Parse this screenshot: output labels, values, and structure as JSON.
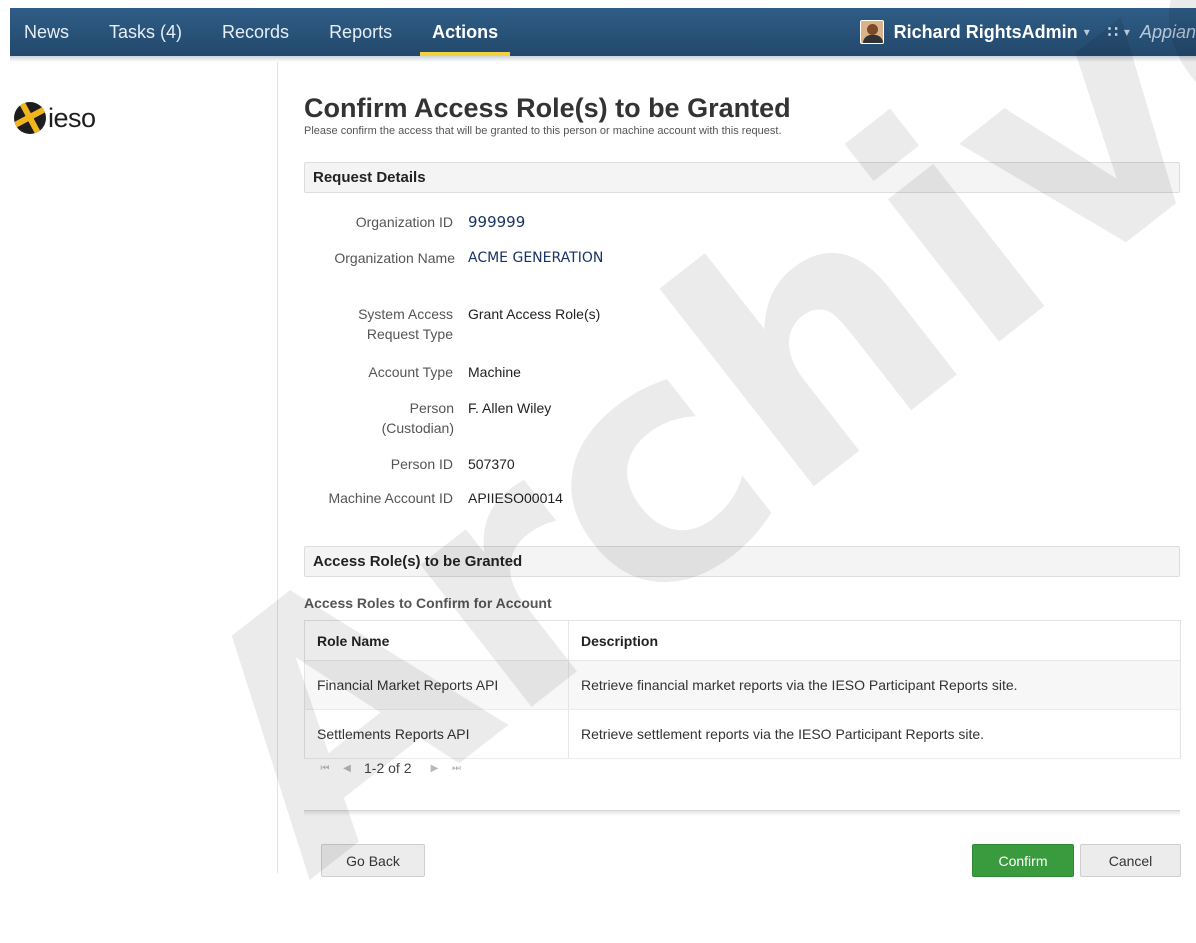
{
  "nav": {
    "items": [
      {
        "label": "News"
      },
      {
        "label": "Tasks (4)"
      },
      {
        "label": "Records"
      },
      {
        "label": "Reports"
      },
      {
        "label": "Actions",
        "active": true
      }
    ],
    "user_name": "Richard RightsAdmin",
    "caret": "▾",
    "grid_caret": "▾",
    "brand": "Appian"
  },
  "logo": {
    "text": "ieso"
  },
  "page": {
    "title": "Confirm Access Role(s) to be Granted",
    "subtitle": "Please confirm the access that will be granted to this person or machine account with this request."
  },
  "request_details": {
    "header": "Request Details",
    "fields": [
      {
        "label": "Organization ID",
        "value": "999999"
      },
      {
        "label": "Organization Name",
        "value": "ACME GENERATION"
      },
      {
        "label": "System Access Request Type",
        "value": "Grant Access Role(s)"
      },
      {
        "label": "Account Type",
        "value": "Machine"
      },
      {
        "label": "Person (Custodian)",
        "value": "F. Allen Wiley"
      },
      {
        "label": "Person ID",
        "value": "507370"
      },
      {
        "label": "Machine Account ID",
        "value": "APIIESO00014"
      }
    ]
  },
  "roles": {
    "header": "Access Role(s) to be Granted",
    "sublabel": "Access Roles to Confirm for Account",
    "columns": [
      "Role Name",
      "Description"
    ],
    "rows": [
      {
        "role": "Financial Market Reports API",
        "description": "Retrieve financial market reports via the IESO Participant Reports site."
      },
      {
        "role": "Settlements Reports API",
        "description": "Retrieve settlement reports via the IESO Participant Reports site."
      }
    ],
    "pager": {
      "text": "1-2 of 2",
      "first_icon": "first-page-icon",
      "prev_icon": "prev-page-icon",
      "next_icon": "next-page-icon",
      "last_icon": "last-page-icon"
    }
  },
  "buttons": {
    "back": "Go Back",
    "confirm": "Confirm",
    "cancel": "Cancel"
  },
  "colors": {
    "nav_bg": "#2a5278",
    "active_underline": "#f2d23e",
    "confirm_green": "#3a9b3e"
  },
  "watermark": "Archive"
}
